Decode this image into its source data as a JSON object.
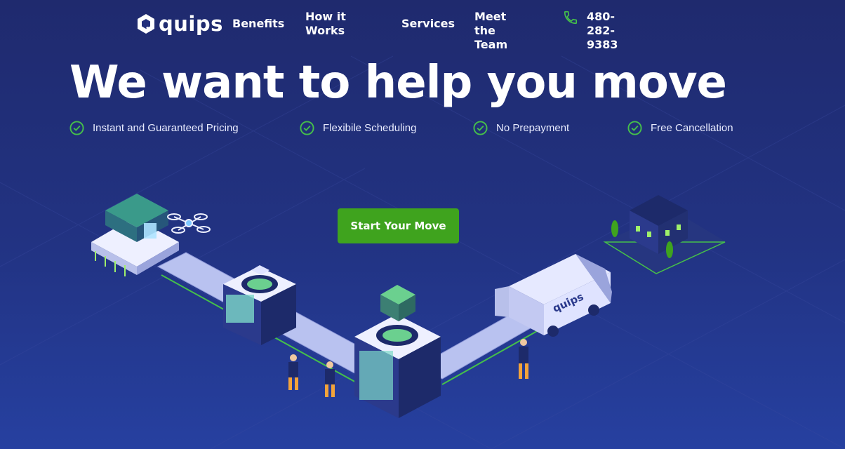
{
  "nav": {
    "logo_text": "quips",
    "links": [
      {
        "label": "Benefits"
      },
      {
        "label": "How it Works"
      },
      {
        "label": "Services"
      },
      {
        "label": "Meet the Team"
      }
    ],
    "phone": "480-282-9383"
  },
  "hero": {
    "title": "We want to help you move",
    "features": [
      "Instant and Guaranteed Pricing",
      "Flexibile Scheduling",
      "No Prepayment",
      "Free Cancellation"
    ],
    "cta_label": "Start Your Move"
  },
  "illustration": {
    "truck_label": "quips"
  },
  "colors": {
    "background": "#222f7c",
    "accent_green": "#3fa31e",
    "check_green": "#45c04a"
  }
}
